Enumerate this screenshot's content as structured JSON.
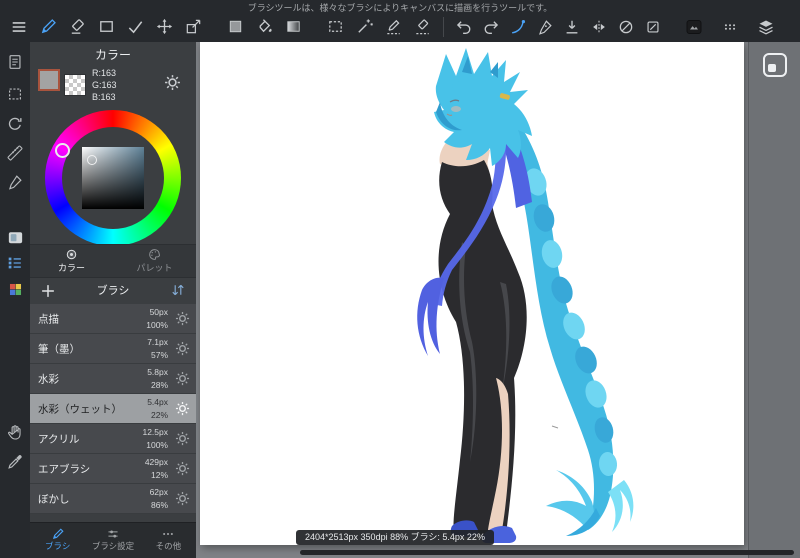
{
  "toolbar": {
    "message": "ブラシツールは、様々なブラシによりキャンバスに描画を行うツールです。",
    "active_tool": "brush",
    "tools": [
      "brush",
      "eraser",
      "shape",
      "dot-pen",
      "move",
      "transform",
      "color-swatch",
      "bucket",
      "gradient",
      "select-rect",
      "magic-wand",
      "select-pen",
      "select-eraser",
      "undo",
      "redo",
      "snap",
      "pen",
      "save",
      "flip-horizontal",
      "rotate-reset",
      "clear",
      "material",
      "drag-handle",
      "layers"
    ]
  },
  "left_rail": {
    "items": [
      "main-menu",
      "canvas-list",
      "select",
      "view-reset",
      "ruler",
      "pen",
      "color-panel",
      "layer-list",
      "materials",
      "hand",
      "eyedropper"
    ]
  },
  "color_panel": {
    "title": "カラー",
    "rgb_r": "R:163",
    "rgb_g": "G:163",
    "rgb_b": "B:163",
    "current_color": "#a3a3a3",
    "tab_color": "カラー",
    "tab_palette": "パレット"
  },
  "brush_panel": {
    "title": "ブラシ",
    "brushes": [
      {
        "name": "点描",
        "size": "50px",
        "opacity": "100%"
      },
      {
        "name": "筆（墨）",
        "size": "7.1px",
        "opacity": "57%"
      },
      {
        "name": "水彩",
        "size": "5.8px",
        "opacity": "28%"
      },
      {
        "name": "水彩（ウェット）",
        "size": "5.4px",
        "opacity": "22%",
        "selected": true
      },
      {
        "name": "アクリル",
        "size": "12.5px",
        "opacity": "100%"
      },
      {
        "name": "エアブラシ",
        "size": "429px",
        "opacity": "12%"
      },
      {
        "name": "ぼかし",
        "size": "62px",
        "opacity": "86%"
      }
    ],
    "tab_brush": "ブラシ",
    "tab_brush_settings": "ブラシ設定",
    "tab_other": "その他"
  },
  "canvas": {
    "status": "2404*2513px 350dpi 88% ブラシ: 5.4px 22%"
  },
  "colors": {
    "accent": "#4aa2f6",
    "panel_bg": "#3b3e41",
    "bar_bg": "#26292d"
  }
}
